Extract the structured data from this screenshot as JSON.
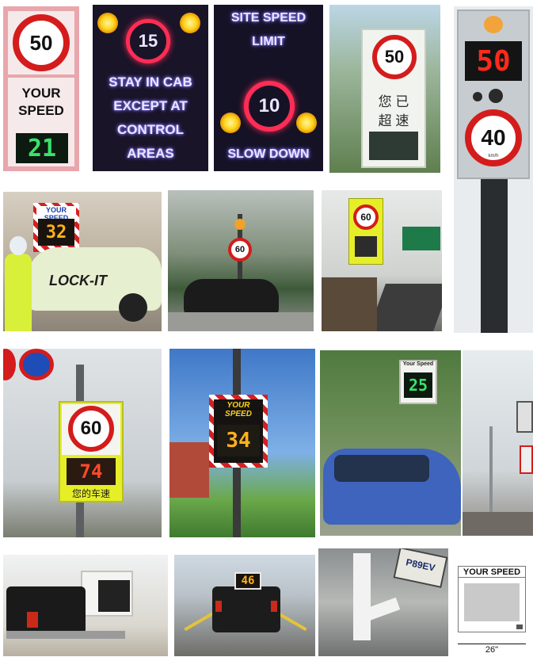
{
  "signs": {
    "s1": {
      "limit": "50",
      "line1": "YOUR",
      "line2": "SPEED",
      "display": "21"
    },
    "s2": {
      "limit": "15",
      "line1": "STAY IN CAB",
      "line2": "EXCEPT AT",
      "line3": "CONTROL",
      "line4": "AREAS"
    },
    "s3": {
      "line1": "SITE SPEED",
      "line2": "LIMIT",
      "limit": "10",
      "footer": "SLOW DOWN"
    },
    "s4": {
      "limit": "50",
      "zh1": "您 已",
      "zh2": "超 速"
    },
    "s5": {
      "display": "50",
      "limit": "40",
      "unit": "km/h"
    },
    "s6": {
      "header": "YOUR SPEED",
      "display": "32",
      "car_text": "LOCK-IT"
    },
    "s7": {
      "limit": "60"
    },
    "s8": {
      "limit": "60"
    },
    "s9": {
      "limit": "60",
      "display": "74",
      "zh": "您的车速"
    },
    "s10": {
      "header": "YOUR SPEED",
      "display": "34"
    },
    "s11": {
      "header": "Your Speed",
      "display": "25"
    },
    "s14": {
      "plate": "P89EV"
    },
    "s15": {
      "header": "YOUR SPEED",
      "dimension": "26\""
    }
  },
  "colors": {
    "sign_red": "#d41c1c",
    "led_red": "#ff2a1a",
    "led_green": "#39e36a",
    "led_amber": "#ffb21a",
    "sign_yellow": "#e6ee28"
  }
}
